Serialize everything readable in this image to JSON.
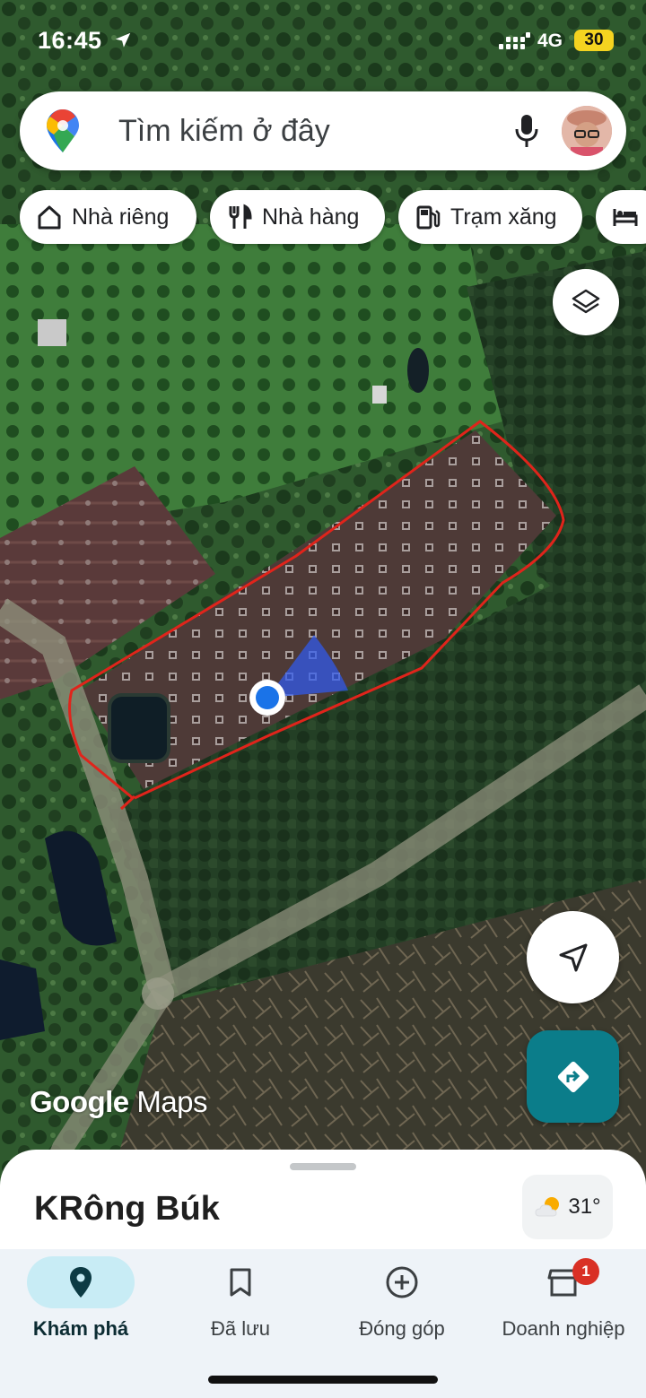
{
  "status_bar": {
    "time": "16:45",
    "network": "4G",
    "battery": "30",
    "battery_color": "#f4d320"
  },
  "search": {
    "placeholder": "Tìm kiếm ở đây",
    "left_icon": "google-maps-pin-icon",
    "right_icons": [
      "mic-icon",
      "avatar"
    ]
  },
  "chips": [
    {
      "label": "Nhà riêng",
      "icon": "home-icon"
    },
    {
      "label": "Nhà hàng",
      "icon": "restaurant-icon"
    },
    {
      "label": "Trạm xăng",
      "icon": "gas-station-icon"
    },
    {
      "label": "",
      "icon": "hotel-icon"
    }
  ],
  "map": {
    "mode": "satellite",
    "watermark_brand": "Google",
    "watermark_product": "Maps",
    "boundary_color": "#e0241b",
    "location_dot_color": "#1a73e8",
    "direction_button_color": "#0b7d8a"
  },
  "bottom_sheet": {
    "place_name": "KRông Búk",
    "temperature": "31°",
    "weather_icon": "partly-sunny-icon"
  },
  "nav": [
    {
      "label": "Khám phá",
      "icon": "explore-pin-icon",
      "active": true
    },
    {
      "label": "Đã lưu",
      "icon": "bookmark-icon",
      "active": false
    },
    {
      "label": "Đóng góp",
      "icon": "add-circle-icon",
      "active": false
    },
    {
      "label": "Doanh nghiệp",
      "icon": "storefront-icon",
      "active": false,
      "badge": "1"
    }
  ]
}
